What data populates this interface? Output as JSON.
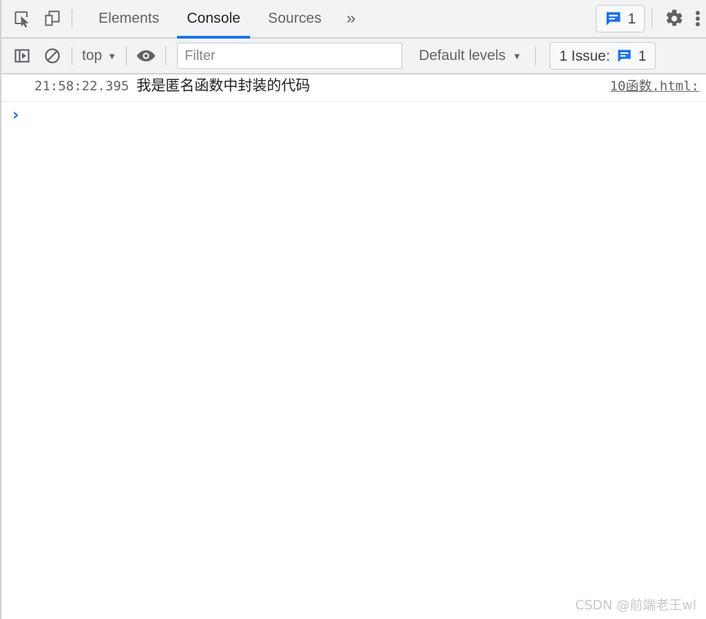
{
  "toolbar": {
    "inspect_icon": "inspect-element-icon",
    "device_icon": "device-toolbar-icon",
    "tabs": [
      {
        "label": "Elements",
        "active": false
      },
      {
        "label": "Console",
        "active": true
      },
      {
        "label": "Sources",
        "active": false
      }
    ],
    "more_tabs_label": "»",
    "issue_badge_count": "1",
    "settings_icon": "gear-icon",
    "more_options_icon": "kebab-menu-icon"
  },
  "console_toolbar": {
    "sidebar_toggle_icon": "console-sidebar-toggle-icon",
    "clear_icon": "clear-console-icon",
    "context_label": "top",
    "context_caret": "▼",
    "eye_icon": "live-expression-eye-icon",
    "filter_placeholder": "Filter",
    "filter_value": "",
    "levels_label": "Default levels",
    "levels_caret": "▼",
    "issues_label": "1 Issue:",
    "issues_count": "1"
  },
  "console_messages": [
    {
      "timestamp": "21:58:22.395",
      "text": "我是匿名函数中封装的代码",
      "source": "10函数.html:"
    }
  ],
  "prompt": {
    "chevron": "›",
    "value": "",
    "placeholder": ""
  },
  "watermark": "CSDN @前端老王wl",
  "colors": {
    "accent": "#1a73e8",
    "toolbar_bg": "#f1f3f4",
    "border": "#cdd0d7",
    "text": "#3c4043",
    "muted_text": "#5f6368"
  }
}
